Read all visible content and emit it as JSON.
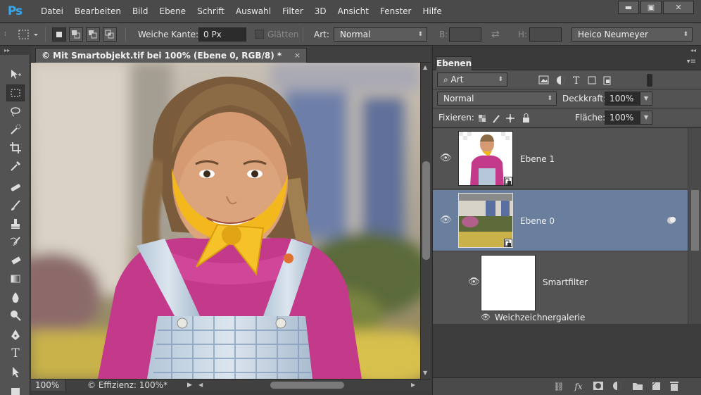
{
  "app": {
    "logo": "Ps"
  },
  "menu": [
    "Datei",
    "Bearbeiten",
    "Bild",
    "Ebene",
    "Schrift",
    "Auswahl",
    "Filter",
    "3D",
    "Ansicht",
    "Fenster",
    "Hilfe"
  ],
  "window_controls": {
    "minimize": "▬",
    "maximize": "▣",
    "close": "✕"
  },
  "options": {
    "feather_label": "Weiche Kante:",
    "feather_value": "0 Px",
    "antialias_label": "Glätten",
    "style_label": "Art:",
    "style_value": "Normal",
    "width_label": "B:",
    "height_label": "H:",
    "swap_icon": "⇄",
    "workspace": "Heico Neumeyer"
  },
  "document": {
    "tab_title": "© Mit Smartobjekt.tif bei 100% (Ebene 0, RGB/8) *",
    "close": "×",
    "zoom": "100%",
    "efficiency": "© Effizienz: 100%*"
  },
  "panel": {
    "tab": "Ebenen",
    "filter_kind": "Art",
    "blend_mode": "Normal",
    "opacity_label": "Deckkraft:",
    "opacity_value": "100%",
    "lock_label": "Fixieren:",
    "fill_label": "Fläche:",
    "fill_value": "100%"
  },
  "layers": [
    {
      "name": "Ebene 1",
      "visible": true,
      "selected": false
    },
    {
      "name": "Ebene 0",
      "visible": true,
      "selected": true
    },
    {
      "name": "Smartfilter",
      "visible": true,
      "selected": false
    },
    {
      "name": "Weichzeichnergalerie",
      "visible": true,
      "selected": false
    }
  ],
  "colors": {
    "selected_layer": "#6a7f9e",
    "panel_bg": "#535353",
    "accent": "#32a8f0"
  }
}
